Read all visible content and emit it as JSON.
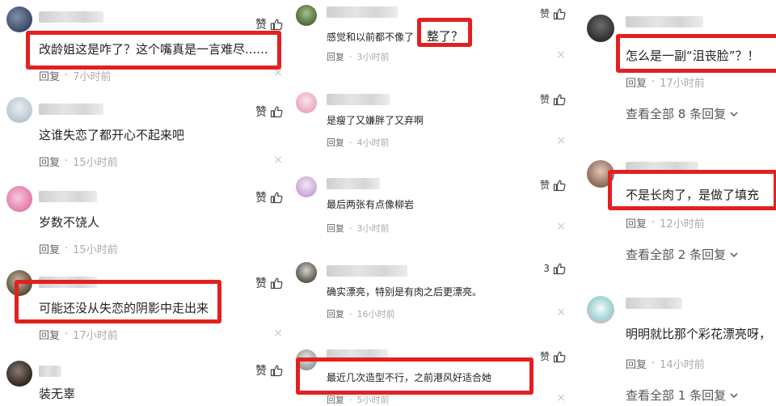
{
  "ui": {
    "like_icon": "thumbs-up-icon",
    "close_icon": "close-icon",
    "highlight_color": "#e32020"
  },
  "col1": [
    {
      "text": "改龄姐这是咋了？这个嘴真是一言难尽......",
      "like": "赞",
      "reply": "回复",
      "dot": "·",
      "time": "7小时前"
    },
    {
      "text": "这谁失恋了都开心不起来吧",
      "like": "赞",
      "reply": "回复",
      "dot": "·",
      "time": "15小时前"
    },
    {
      "text": "岁数不饶人",
      "like": "赞",
      "reply": "回复",
      "dot": "·",
      "time": "15小时前"
    },
    {
      "text": "可能还没从失恋的阴影中走出来",
      "like": "赞",
      "reply": "回复",
      "dot": "·",
      "time": "17小时前"
    },
    {
      "text": "装无辜",
      "like": "赞"
    }
  ],
  "col2": [
    {
      "text_a": "感觉和以前都不像了",
      "text_b": "整了？",
      "like": "赞",
      "reply": "回复",
      "dot": "·",
      "time": "3小时前"
    },
    {
      "text": "是瘦了又嫌胖了又弃啊",
      "like": "赞",
      "reply": "回复",
      "dot": "·",
      "time": "4小时前"
    },
    {
      "text": "最后两张有点像柳岩",
      "like": "赞",
      "reply": "回复",
      "dot": "·",
      "time": "3小时前"
    },
    {
      "text": "确实漂亮，特别是有肉之后更漂亮。",
      "like": "3",
      "reply": "回复",
      "dot": "·",
      "time": "16小时前"
    },
    {
      "text": "最近几次造型不行，之前港风好适合她",
      "like": "赞",
      "reply": "回复",
      "dot": "·",
      "time": "5小时前"
    }
  ],
  "col3": [
    {
      "text": "怎么是一副“沮丧脸”？！",
      "reply": "回复",
      "dot": "·",
      "time": "17小时前",
      "view_all": "查看全部 8 条回复"
    },
    {
      "text": "不是长肉了，是做了填充",
      "reply": "回复",
      "dot": "·",
      "time": "12小时前",
      "view_all": "查看全部 2 条回复"
    },
    {
      "text": "明明就比那个彩花漂亮呀，",
      "reply": "回复",
      "dot": "·",
      "time": "14小时前",
      "view_all": "查看全部 1 条回复"
    }
  ]
}
